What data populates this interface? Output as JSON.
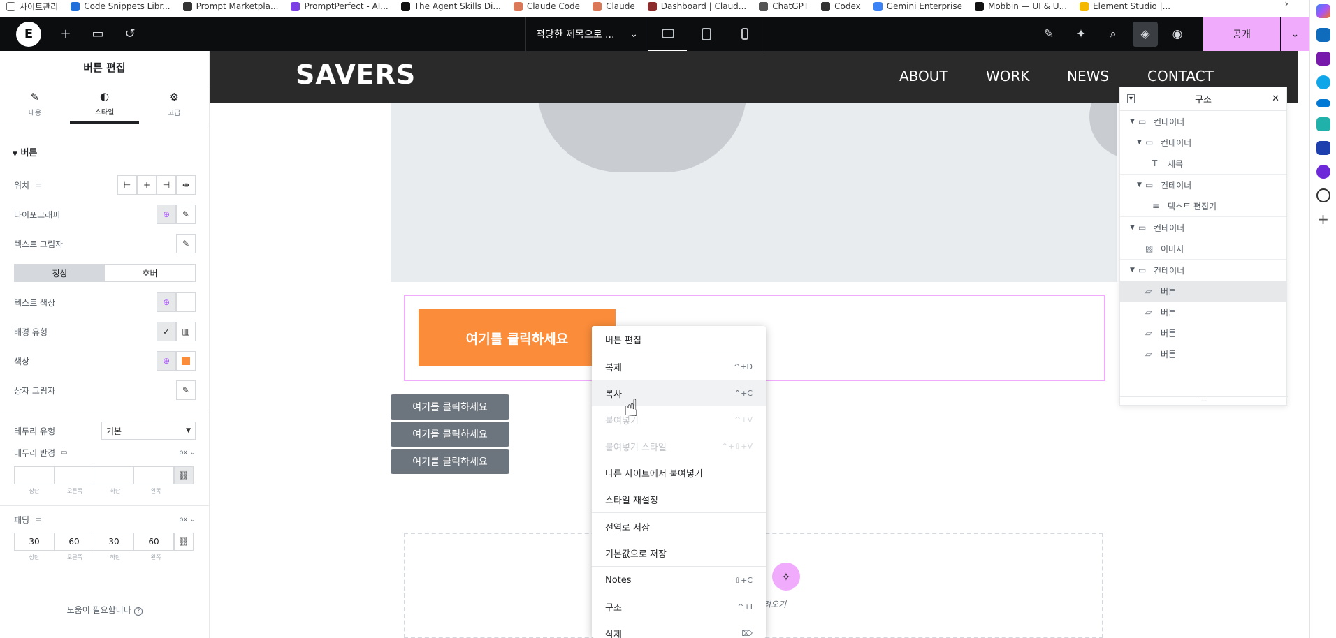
{
  "bookmarks": [
    {
      "label": "사이트관리",
      "color": "#ffffff"
    },
    {
      "label": "Code Snippets Libr...",
      "color": "#1e6fd9"
    },
    {
      "label": "Prompt Marketpla...",
      "color": "#333333"
    },
    {
      "label": "PromptPerfect - AI...",
      "color": "#7b3fe4"
    },
    {
      "label": "The Agent Skills Di...",
      "color": "#111111"
    },
    {
      "label": "Claude Code",
      "color": "#d97757"
    },
    {
      "label": "Claude",
      "color": "#d97757"
    },
    {
      "label": "Dashboard | Claud...",
      "color": "#8b2b2b"
    },
    {
      "label": "ChatGPT",
      "color": "#555555"
    },
    {
      "label": "Codex",
      "color": "#333333"
    },
    {
      "label": "Gemini Enterprise",
      "color": "#3b82f6"
    },
    {
      "label": "Mobbin — UI & U...",
      "color": "#111111"
    },
    {
      "label": "Element Studio |...",
      "color": "#f5b800"
    }
  ],
  "topbar": {
    "doc_title": "적당한 제목으로 ...",
    "publish_label": "공개"
  },
  "panel": {
    "title": "버튼 편집",
    "tabs": [
      {
        "label": "내용",
        "icon": "pencil-icon"
      },
      {
        "label": "스타일",
        "icon": "contrast-icon"
      },
      {
        "label": "고급",
        "icon": "gear-icon"
      }
    ],
    "section": "버튼",
    "position_label": "위치",
    "typography_label": "타이포그래피",
    "text_shadow_label": "텍스트 그림자",
    "state_normal": "정상",
    "state_hover": "호버",
    "text_color_label": "텍스트 색상",
    "bg_type_label": "배경 유형",
    "color_label": "색상",
    "color_value": "#fa8c3a",
    "box_shadow_label": "상자 그림자",
    "border_type_label": "테두리 유형",
    "border_type_value": "기본",
    "border_radius_label": "테두리 반경",
    "unit": "px",
    "dim_labels": [
      "상단",
      "오른쪽",
      "하단",
      "왼쪽"
    ],
    "padding_label": "패딩",
    "padding_values": [
      "30",
      "60",
      "30",
      "60"
    ],
    "help": "도움이 필요합니다"
  },
  "site": {
    "brand": "SAVERS",
    "nav": [
      "ABOUT",
      "WORK",
      "NEWS",
      "CONTACT"
    ],
    "big_button": "여기를 클릭하세요",
    "small_buttons": [
      "여기를 클릭하세요",
      "여기를 클릭하세요",
      "여기를 클릭하세요"
    ],
    "drop_text_visible": "려오기"
  },
  "context_menu": [
    {
      "label": "버튼 편집",
      "shortcut": "",
      "state": "normal"
    },
    {
      "sep": true
    },
    {
      "label": "복제",
      "shortcut": "^+D",
      "state": "normal"
    },
    {
      "label": "복사",
      "shortcut": "^+C",
      "state": "hover"
    },
    {
      "label": "붙여넣기",
      "shortcut": "^+V",
      "state": "disabled"
    },
    {
      "label": "붙여넣기 스타일",
      "shortcut": "^+⇧+V",
      "state": "disabled"
    },
    {
      "label": "다른 사이트에서 붙여넣기",
      "shortcut": "",
      "state": "normal"
    },
    {
      "label": "스타일 재설정",
      "shortcut": "",
      "state": "normal"
    },
    {
      "sep": true
    },
    {
      "label": "전역로 저장",
      "shortcut": "",
      "state": "normal"
    },
    {
      "label": "기본값으로 저장",
      "shortcut": "",
      "state": "normal"
    },
    {
      "sep": true
    },
    {
      "label": "Notes",
      "shortcut": "⇧+C",
      "state": "normal"
    },
    {
      "label": "구조",
      "shortcut": "^+I",
      "state": "normal"
    },
    {
      "label": "삭제",
      "shortcut": "⌦",
      "state": "normal"
    }
  ],
  "navigator": {
    "title": "구조",
    "items": [
      {
        "label": "컨테이너",
        "level": 0,
        "arrow": true,
        "icon": "container-icon"
      },
      {
        "label": "컨테이너",
        "level": 1,
        "arrow": true,
        "icon": "container-icon"
      },
      {
        "label": "제목",
        "level": 2,
        "arrow": false,
        "icon": "heading-icon"
      },
      {
        "sep": true
      },
      {
        "label": "컨테이너",
        "level": 1,
        "arrow": true,
        "icon": "container-icon"
      },
      {
        "label": "텍스트 편집기",
        "level": 2,
        "arrow": false,
        "icon": "text-editor-icon"
      },
      {
        "sep": true
      },
      {
        "label": "컨테이너",
        "level": 0,
        "arrow": true,
        "icon": "container-icon"
      },
      {
        "label": "이미지",
        "level": 1,
        "arrow": false,
        "icon": "image-icon"
      },
      {
        "sep": true
      },
      {
        "label": "컨테이너",
        "level": 0,
        "arrow": true,
        "icon": "container-icon"
      },
      {
        "label": "버튼",
        "level": 1,
        "arrow": false,
        "icon": "button-icon",
        "selected": true
      },
      {
        "label": "버튼",
        "level": 1,
        "arrow": false,
        "icon": "button-icon"
      },
      {
        "label": "버튼",
        "level": 1,
        "arrow": false,
        "icon": "button-icon"
      },
      {
        "label": "버튼",
        "level": 1,
        "arrow": false,
        "icon": "button-icon"
      }
    ],
    "footer": "..."
  }
}
